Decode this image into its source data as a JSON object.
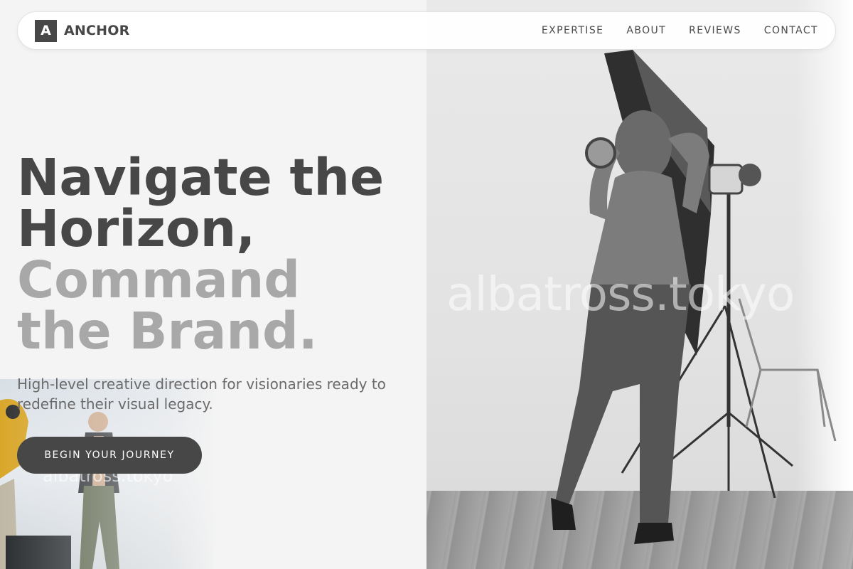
{
  "nav": {
    "logo_mark": "A",
    "brand": "ANCHOR",
    "links": [
      "EXPERTISE",
      "ABOUT",
      "REVIEWS",
      "CONTACT"
    ]
  },
  "hero": {
    "title_dark": [
      "Navigate the",
      "Horizon,"
    ],
    "title_light": [
      "Command",
      "the Brand."
    ],
    "subtitle": "High-level creative direction for visionaries ready to redefine their visual legacy.",
    "cta": "BEGIN YOUR JOURNEY"
  },
  "watermark": "albatross.tokyo",
  "colors": {
    "primary": "#474747",
    "muted_heading": "#a8a8a8",
    "body_text": "#6a6a6a",
    "background": "#f4f4f4"
  }
}
